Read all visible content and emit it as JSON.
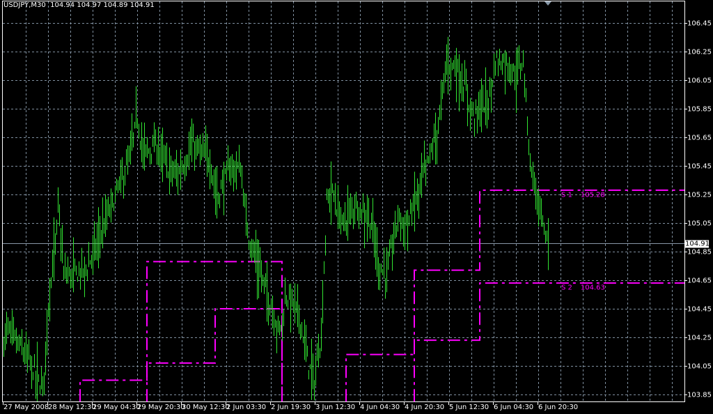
{
  "header": {
    "symbol": "USDJPY,M30",
    "open": "104.94",
    "high": "104.97",
    "low": "104.89",
    "close": "104.91"
  },
  "current_price": "104.91",
  "colors": {
    "bars": "#32e632",
    "grid": "#8090a0",
    "levels": "#ff00ff",
    "background": "#000000",
    "axis": "#ffffff",
    "bid_line": "#8898a8"
  },
  "chart_data": {
    "type": "bar",
    "title": "USDJPY,M30",
    "ylim": [
      103.8,
      106.55
    ],
    "y_ticks": [
      "106.45",
      "106.25",
      "106.05",
      "105.85",
      "105.65",
      "105.45",
      "105.25",
      "105.05",
      "104.85",
      "104.65",
      "104.45",
      "104.25",
      "104.05",
      "103.85"
    ],
    "x_ticks": [
      "27 May 2008",
      "28 May 12:30",
      "29 May 04:30",
      "29 May 20:30",
      "30 May 12:30",
      "2 Jun 03:30",
      "2 Jun 19:30",
      "3 Jun 12:30",
      "4 Jun 04:30",
      "4 Jun 20:30",
      "5 Jun 12:30",
      "6 Jun 04:30",
      "6 Jun 20:30"
    ],
    "bars_per_x_tick": 32,
    "bar_count": 392,
    "price_path": [
      [
        0,
        104.25
      ],
      [
        3,
        104.32
      ],
      [
        18,
        104.1
      ],
      [
        28,
        103.9
      ],
      [
        32,
        104.5
      ],
      [
        38,
        105.0
      ],
      [
        39,
        105.2
      ],
      [
        43,
        104.7
      ],
      [
        48,
        104.7
      ],
      [
        60,
        104.75
      ],
      [
        68,
        104.95
      ],
      [
        78,
        105.2
      ],
      [
        90,
        105.5
      ],
      [
        96,
        105.8
      ],
      [
        100,
        105.55
      ],
      [
        110,
        105.6
      ],
      [
        118,
        105.45
      ],
      [
        125,
        105.4
      ],
      [
        135,
        105.6
      ],
      [
        148,
        105.5
      ],
      [
        153,
        105.25
      ],
      [
        163,
        105.45
      ],
      [
        170,
        105.45
      ],
      [
        175,
        105.0
      ],
      [
        183,
        104.75
      ],
      [
        190,
        104.55
      ],
      [
        198,
        104.3
      ],
      [
        203,
        104.55
      ],
      [
        208,
        104.5
      ],
      [
        213,
        104.4
      ],
      [
        218,
        104.1
      ],
      [
        223,
        103.95
      ],
      [
        228,
        104.3
      ],
      [
        232,
        105.2
      ],
      [
        235,
        105.3
      ],
      [
        243,
        105.05
      ],
      [
        253,
        105.2
      ],
      [
        263,
        105.1
      ],
      [
        270,
        104.75
      ],
      [
        275,
        104.7
      ],
      [
        283,
        105.1
      ],
      [
        290,
        105.05
      ],
      [
        298,
        105.3
      ],
      [
        308,
        105.6
      ],
      [
        313,
        105.8
      ],
      [
        318,
        106.2
      ],
      [
        325,
        106.15
      ],
      [
        333,
        105.95
      ],
      [
        338,
        105.8
      ],
      [
        343,
        105.9
      ],
      [
        348,
        105.9
      ],
      [
        353,
        106.2
      ],
      [
        360,
        106.2
      ],
      [
        368,
        106.1
      ],
      [
        373,
        106.2
      ],
      [
        378,
        105.5
      ],
      [
        383,
        105.25
      ],
      [
        388,
        105.0
      ],
      [
        391,
        104.93
      ]
    ],
    "levels": [
      {
        "name": "line-1",
        "points": [
          [
            55,
            103.8
          ],
          [
            55,
            103.95
          ],
          [
            103,
            103.95
          ],
          [
            103,
            104.78
          ],
          [
            200,
            104.78
          ],
          [
            200,
            103.8
          ]
        ]
      },
      {
        "name": "line-2",
        "points": [
          [
            103,
            103.8
          ],
          [
            103,
            104.07
          ],
          [
            152,
            104.07
          ],
          [
            152,
            104.45
          ],
          [
            200,
            104.45
          ],
          [
            200,
            103.8
          ]
        ]
      },
      {
        "name": "line-3",
        "points": [
          [
            246,
            103.8
          ],
          [
            246,
            104.13
          ],
          [
            295,
            104.13
          ],
          [
            295,
            104.72
          ],
          [
            342,
            104.72
          ],
          [
            342,
            105.28
          ],
          [
            489,
            105.28
          ]
        ]
      },
      {
        "name": "line-4",
        "points": [
          [
            295,
            103.8
          ],
          [
            295,
            104.23
          ],
          [
            342,
            104.23
          ],
          [
            342,
            104.63
          ],
          [
            489,
            104.63
          ]
        ]
      }
    ],
    "level_labels": [
      {
        "name": "S 1",
        "value": "105.28",
        "price": 105.28
      },
      {
        "name": "S 2",
        "value": "104.63",
        "price": 104.63
      }
    ]
  }
}
